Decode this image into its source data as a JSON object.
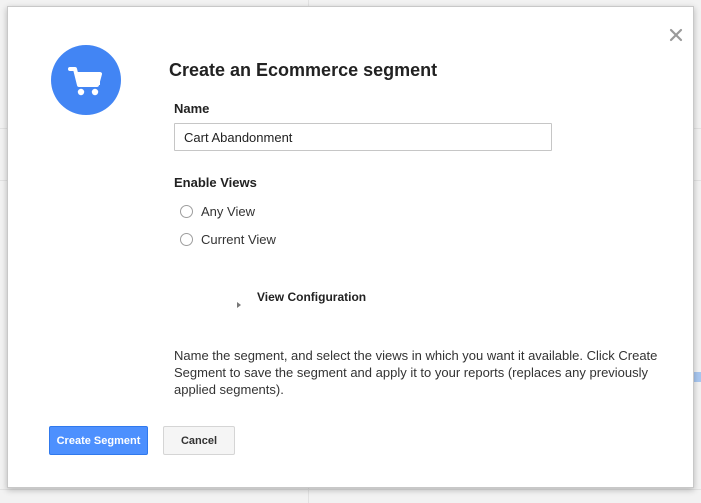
{
  "dialog": {
    "title": "Create an Ecommerce segment",
    "icon": "cart-icon",
    "close_icon": "close-icon",
    "accent_color": "#4285f4"
  },
  "name_field": {
    "label": "Name",
    "value": "Cart Abandonment"
  },
  "enable_views": {
    "label": "Enable Views",
    "options": [
      {
        "label": "Any View",
        "selected": false
      },
      {
        "label": "Current View",
        "selected": false
      }
    ]
  },
  "view_configuration": {
    "label": "View Configuration",
    "expanded": false
  },
  "description": "Name the segment, and select the views in which you want it available. Click Create Segment to save the segment and apply it to your reports (replaces any previously applied segments).",
  "buttons": {
    "create_label": "Create Segment",
    "cancel_label": "Cancel"
  }
}
